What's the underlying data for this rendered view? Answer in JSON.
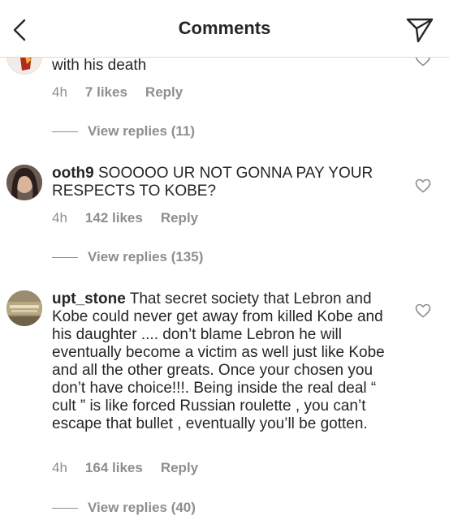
{
  "header": {
    "title": "Comments",
    "back_icon": "chevron-left-icon",
    "share_icon": "paper-plane-icon"
  },
  "comments": [
    {
      "username": "",
      "text": "with his death",
      "time": "4h",
      "likes": "7 likes",
      "reply": "Reply",
      "view_replies": "View replies (11)"
    },
    {
      "username": "ooth9",
      "text": "SOOOOO UR NOT GONNA PAY YOUR RESPECTS TO KOBE?",
      "time": "4h",
      "likes": "142 likes",
      "reply": "Reply",
      "view_replies": "View replies (135)"
    },
    {
      "username": "upt_stone",
      "text": "That secret society that Lebron and Kobe could never get away from killed Kobe and his daughter .... don’t blame Lebron he will eventually become a victim as well just like Kobe and all the other greats. Once your chosen you don’t have choice!!!. Being inside the real deal “ cult ”  is like forced Russian roulette , you can’t escape that bullet , eventually you’ll be gotten.",
      "time": "4h",
      "likes": "164 likes",
      "reply": "Reply",
      "view_replies": "View replies (40)"
    }
  ],
  "colors": {
    "text": "#262626",
    "secondary": "#8e8e8e",
    "divider": "#dbdbdb"
  }
}
